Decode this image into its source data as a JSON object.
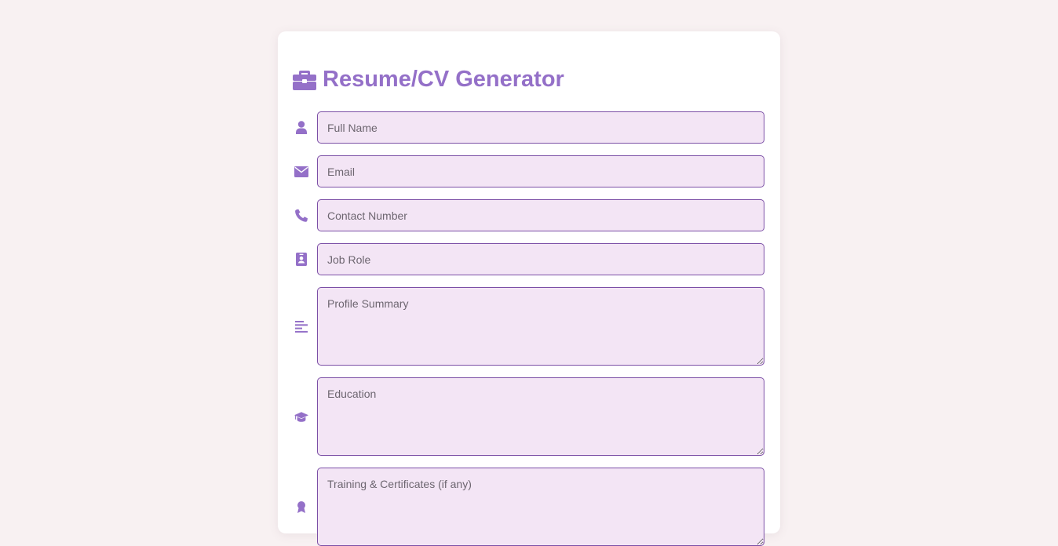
{
  "form": {
    "title": "Resume/CV Generator",
    "title_icon": "briefcase-icon",
    "fields": [
      {
        "icon": "user-icon",
        "placeholder": "Full Name",
        "type": "input"
      },
      {
        "icon": "envelope-icon",
        "placeholder": "Email",
        "type": "input"
      },
      {
        "icon": "phone-icon",
        "placeholder": "Contact Number",
        "type": "input"
      },
      {
        "icon": "id-badge-icon",
        "placeholder": "Job Role",
        "type": "input"
      },
      {
        "icon": "align-left-icon",
        "placeholder": "Profile Summary",
        "type": "textarea"
      },
      {
        "icon": "graduation-cap-icon",
        "placeholder": "Education",
        "type": "textarea"
      },
      {
        "icon": "certificate-icon",
        "placeholder": "Training & Certificates (if any)",
        "type": "textarea"
      }
    ]
  },
  "colors": {
    "accent": "#9470c8",
    "field_bg": "#f3e5f5",
    "field_border": "#7b4fa6",
    "page_bg": "#f8f1f2",
    "card_bg": "#ffffff"
  }
}
